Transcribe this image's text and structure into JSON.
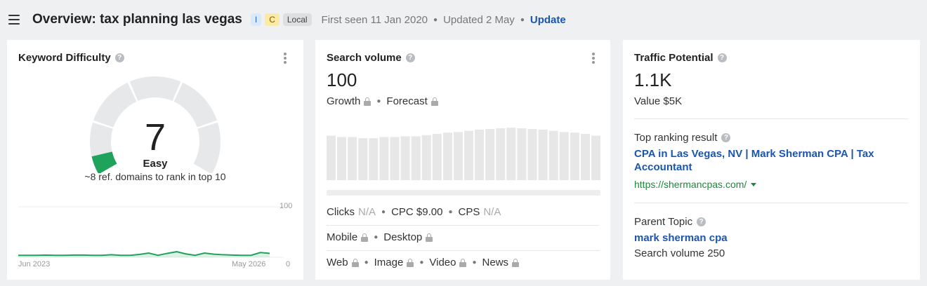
{
  "header": {
    "title": "Overview: tax planning las vegas",
    "badges": [
      "I",
      "C",
      "Local"
    ],
    "first_seen": "First seen 11 Jan 2020",
    "updated": "Updated 2 May",
    "update_label": "Update"
  },
  "keyword_difficulty": {
    "title": "Keyword Difficulty",
    "value": "7",
    "level": "Easy",
    "description": "~8 ref. domains to rank in top 10",
    "gauge_fraction": 0.07,
    "gauge_color": "#1fa35c",
    "chart_data": {
      "type": "area",
      "x_labels": [
        "Jun 2023",
        "May 2026"
      ],
      "ylim": [
        0,
        100
      ],
      "y_ticks": [
        "100",
        "0"
      ],
      "values": [
        7,
        7,
        7,
        8,
        7,
        7,
        8,
        8,
        7,
        7,
        9,
        7,
        7,
        10,
        15,
        7,
        14,
        20,
        12,
        7,
        15,
        11,
        9,
        8,
        7,
        7,
        17,
        14
      ],
      "color": "#1fa35c"
    }
  },
  "search_volume": {
    "title": "Search volume",
    "value": "100",
    "growth_label": "Growth",
    "forecast_label": "Forecast",
    "chart_data": {
      "type": "bar",
      "values": [
        72,
        70,
        70,
        68,
        68,
        70,
        70,
        71,
        71,
        73,
        75,
        77,
        78,
        80,
        82,
        83,
        84,
        85,
        84,
        83,
        82,
        80,
        78,
        77,
        75,
        72
      ],
      "color": "#e7e7e7"
    },
    "clicks_label": "Clicks",
    "clicks_value": "N/A",
    "cpc_label": "CPC $9.00",
    "cps_label": "CPS",
    "cps_value": "N/A",
    "mobile_label": "Mobile",
    "desktop_label": "Desktop",
    "web_label": "Web",
    "image_label": "Image",
    "video_label": "Video",
    "news_label": "News"
  },
  "traffic_potential": {
    "title": "Traffic Potential",
    "value": "1.1K",
    "value_text": "Value $5K",
    "top_result_label": "Top ranking result",
    "top_result_title": "CPA in Las Vegas, NV | Mark Sherman CPA | Tax Accountant",
    "top_result_url": "https://shermancpas.com/",
    "parent_topic_label": "Parent Topic",
    "parent_topic": "mark sherman cpa",
    "parent_volume": "Search volume 250"
  }
}
